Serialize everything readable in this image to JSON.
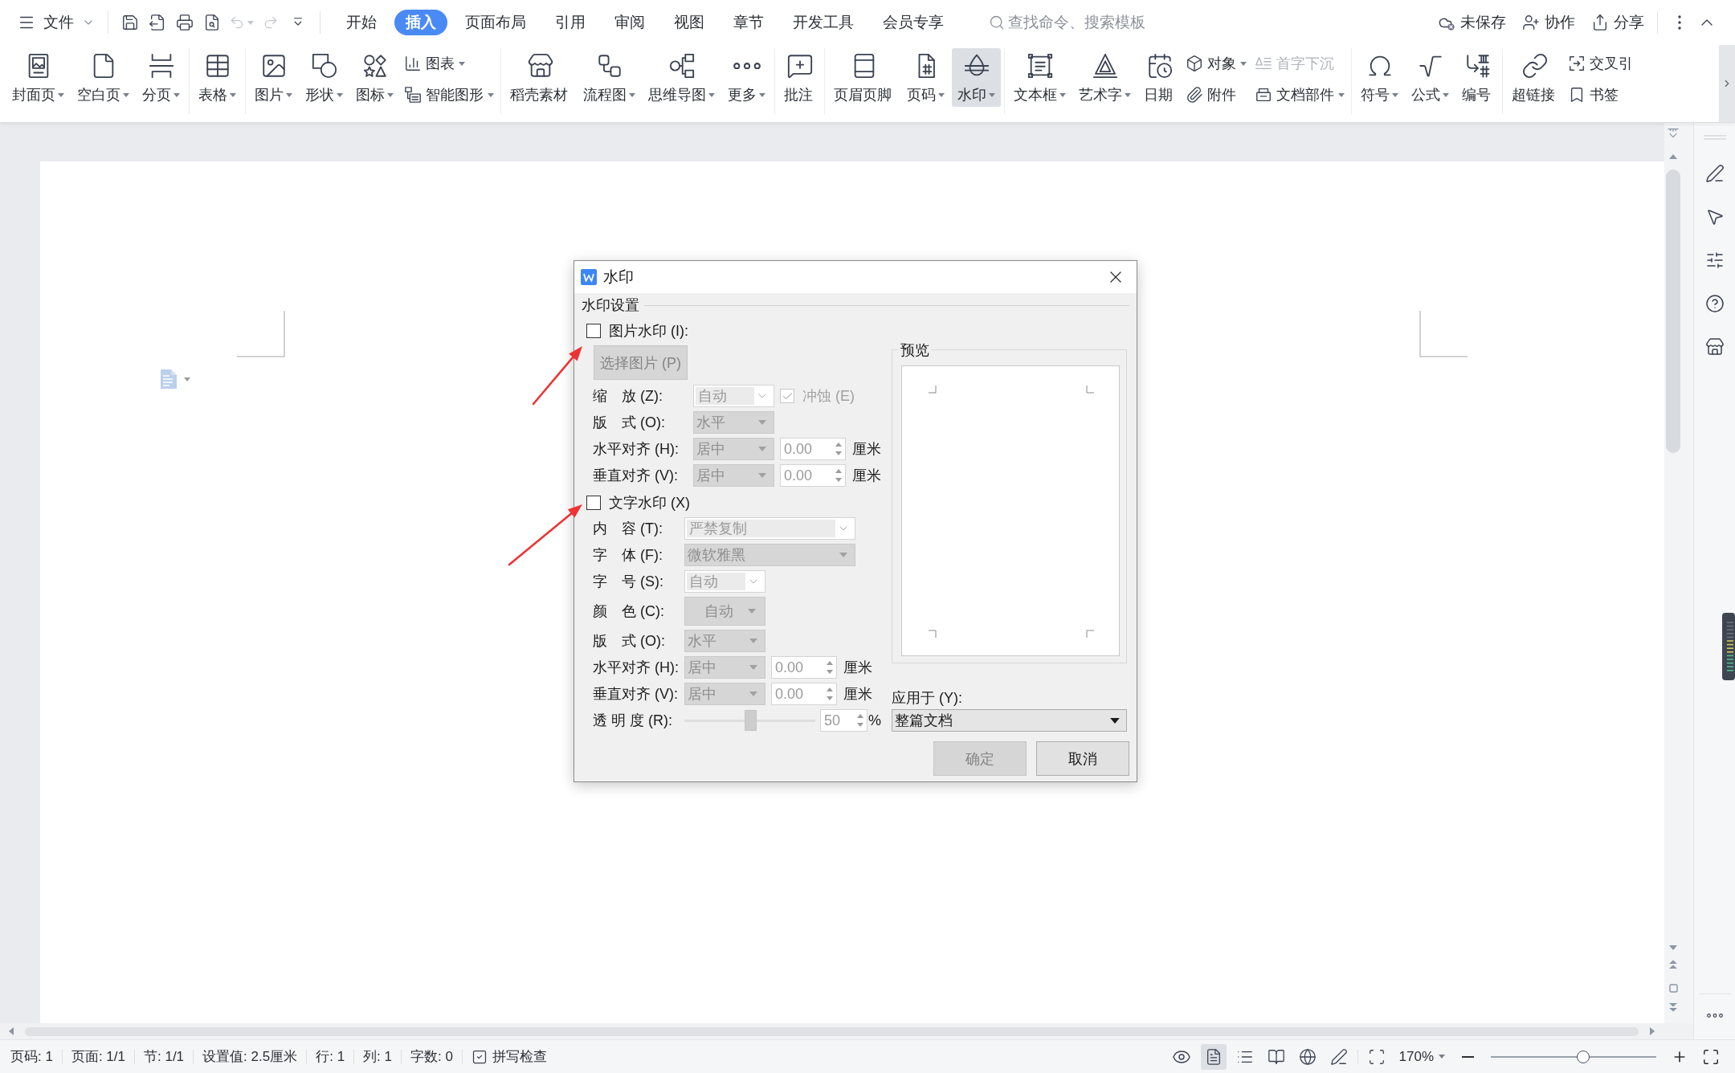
{
  "menu_bar": {
    "file_menu": {
      "label": "文件"
    },
    "undo": {
      "disabled": true
    },
    "redo": {
      "disabled": true
    },
    "tabs": [
      {
        "label": "开始",
        "selected": false
      },
      {
        "label": "插入",
        "selected": true
      },
      {
        "label": "页面布局",
        "selected": false
      },
      {
        "label": "引用",
        "selected": false
      },
      {
        "label": "审阅",
        "selected": false
      },
      {
        "label": "视图",
        "selected": false
      },
      {
        "label": "章节",
        "selected": false
      },
      {
        "label": "开发工具",
        "selected": false
      },
      {
        "label": "会员专享",
        "selected": false
      }
    ],
    "search": {
      "placeholder": "查找命令、搜索模板"
    },
    "actions": [
      {
        "label": "未保存"
      },
      {
        "label": "协作"
      },
      {
        "label": "分享"
      }
    ]
  },
  "ribbon": {
    "groups": [
      {
        "items": [
          {
            "kind": "large",
            "label": "封面页",
            "dropdown": true,
            "selected": false,
            "disabled": false
          },
          {
            "kind": "large",
            "label": "空白页",
            "dropdown": true,
            "selected": false,
            "disabled": false
          },
          {
            "kind": "large",
            "label": "分页",
            "dropdown": true,
            "selected": false,
            "disabled": false
          }
        ]
      },
      {
        "items": [
          {
            "kind": "large",
            "label": "表格",
            "dropdown": true,
            "selected": false,
            "disabled": false
          }
        ]
      },
      {
        "items": [
          {
            "kind": "large",
            "label": "图片",
            "dropdown": true,
            "selected": false,
            "disabled": false
          },
          {
            "kind": "large",
            "label": "形状",
            "dropdown": true,
            "selected": false,
            "disabled": false
          },
          {
            "kind": "large",
            "label": "图标",
            "dropdown": true,
            "selected": false,
            "disabled": false
          },
          {
            "kind": "stack",
            "items": [
              {
                "label": "图表",
                "dropdown": true,
                "selected": false,
                "disabled": false
              },
              {
                "label": "智能图形",
                "dropdown": true,
                "selected": false,
                "disabled": false
              }
            ]
          }
        ]
      },
      {
        "items": [
          {
            "kind": "large",
            "label": "稻壳素材",
            "dropdown": false,
            "selected": false,
            "disabled": false
          },
          {
            "kind": "large",
            "label": "流程图",
            "dropdown": true,
            "selected": false,
            "disabled": false
          },
          {
            "kind": "large",
            "label": "思维导图",
            "dropdown": true,
            "selected": false,
            "disabled": false
          },
          {
            "kind": "large",
            "label": "更多",
            "dropdown": true,
            "selected": false,
            "disabled": false
          }
        ]
      },
      {
        "items": [
          {
            "kind": "large",
            "label": "批注",
            "dropdown": false,
            "selected": false,
            "disabled": false
          }
        ]
      },
      {
        "items": [
          {
            "kind": "large",
            "label": "页眉页脚",
            "dropdown": false,
            "selected": false,
            "disabled": false
          },
          {
            "kind": "large",
            "label": "页码",
            "dropdown": true,
            "selected": false,
            "disabled": false
          },
          {
            "kind": "large",
            "label": "水印",
            "dropdown": true,
            "selected": true,
            "disabled": false
          }
        ]
      },
      {
        "items": [
          {
            "kind": "large",
            "label": "文本框",
            "dropdown": true,
            "selected": false,
            "disabled": false
          },
          {
            "kind": "large",
            "label": "艺术字",
            "dropdown": true,
            "selected": false,
            "disabled": false
          },
          {
            "kind": "large",
            "label": "日期",
            "dropdown": false,
            "selected": false,
            "disabled": false
          },
          {
            "kind": "stack",
            "items": [
              {
                "label": "对象",
                "dropdown": true,
                "selected": false,
                "disabled": false
              },
              {
                "label": "附件",
                "dropdown": false,
                "selected": false,
                "disabled": false
              }
            ]
          },
          {
            "kind": "stack",
            "items": [
              {
                "label": "首字下沉",
                "dropdown": false,
                "selected": false,
                "disabled": true
              },
              {
                "label": "文档部件",
                "dropdown": true,
                "selected": false,
                "disabled": false
              }
            ]
          }
        ]
      },
      {
        "items": [
          {
            "kind": "large",
            "label": "符号",
            "dropdown": true,
            "selected": false,
            "disabled": false
          },
          {
            "kind": "large",
            "label": "公式",
            "dropdown": true,
            "selected": false,
            "disabled": false
          },
          {
            "kind": "large",
            "label": "编号",
            "dropdown": false,
            "selected": false,
            "disabled": false
          }
        ]
      },
      {
        "items": [
          {
            "kind": "large",
            "label": "超链接",
            "dropdown": false,
            "selected": false,
            "disabled": false
          },
          {
            "kind": "stack",
            "items": [
              {
                "label": "交叉引",
                "dropdown": false,
                "selected": false,
                "disabled": false
              },
              {
                "label": "书签",
                "dropdown": false,
                "selected": false,
                "disabled": false
              }
            ]
          }
        ]
      }
    ]
  },
  "dialog": {
    "title": "水印",
    "group_title": "水印设置",
    "picture_watermark": {
      "label": "图片水印 (I):",
      "checked": false,
      "select_button": {
        "label": "选择图片 (P)",
        "disabled": true
      },
      "rows": [
        {
          "kind": "combo",
          "label": "缩　放 (Z):",
          "value": "自动",
          "disabled": true,
          "option": {
            "label": "冲蚀 (E)",
            "checked": true,
            "disabled": true
          }
        },
        {
          "kind": "dropdown",
          "label": "版　式 (O):",
          "value": "水平",
          "disabled": true
        },
        {
          "kind": "dropdown",
          "label": "水平对齐 (H):",
          "value": "居中",
          "disabled": true,
          "offset": {
            "value": "0.00",
            "unit": "厘米"
          }
        },
        {
          "kind": "dropdown",
          "label": "垂直对齐 (V):",
          "value": "居中",
          "disabled": true,
          "offset": {
            "value": "0.00",
            "unit": "厘米"
          }
        }
      ]
    },
    "text_watermark": {
      "label": "文字水印 (X)",
      "checked": false,
      "rows": [
        {
          "kind": "wide_combo",
          "label": "内　容 (T):",
          "value": "严禁复制",
          "disabled": true
        },
        {
          "kind": "wide_dropdown",
          "label": "字　体 (F):",
          "value": "微软雅黑",
          "disabled": true
        },
        {
          "kind": "combo",
          "label": "字　号 (S):",
          "value": "自动",
          "disabled": true
        },
        {
          "kind": "color",
          "label": "颜　色 (C):",
          "value": "自动",
          "disabled": true
        },
        {
          "kind": "dropdown",
          "label": "版　式 (O):",
          "value": "水平",
          "disabled": true
        },
        {
          "kind": "dropdown",
          "label": "水平对齐 (H):",
          "value": "居中",
          "disabled": true,
          "offset": {
            "value": "0.00",
            "unit": "厘米"
          }
        },
        {
          "kind": "dropdown",
          "label": "垂直对齐 (V):",
          "value": "居中",
          "disabled": true,
          "offset": {
            "value": "0.00",
            "unit": "厘米"
          }
        },
        {
          "kind": "slider",
          "label": "透 明 度 (R):",
          "level": 0.5,
          "disabled": true,
          "reading": {
            "value": "50",
            "unit": "%"
          }
        }
      ]
    },
    "preview": {
      "title": "预览"
    },
    "apply_to": {
      "label": "应用于 (Y):",
      "value": "整篇文档"
    },
    "buttons": [
      {
        "label": "确定",
        "disabled": true
      },
      {
        "label": "取消",
        "disabled": false
      }
    ]
  },
  "status_bar": {
    "fields": [
      "页码: 1",
      "页面: 1/1",
      "节: 1/1",
      "设置值: 2.5厘米",
      "行: 1",
      "列: 1",
      "字数: 0"
    ],
    "spell_check": {
      "label": "拼写检查"
    },
    "views": [
      {
        "selected": true
      },
      {
        "selected": false
      },
      {
        "selected": false
      },
      {
        "selected": false
      },
      {
        "selected": false
      }
    ],
    "zoom": {
      "value": "170%",
      "level": 0.56
    }
  }
}
